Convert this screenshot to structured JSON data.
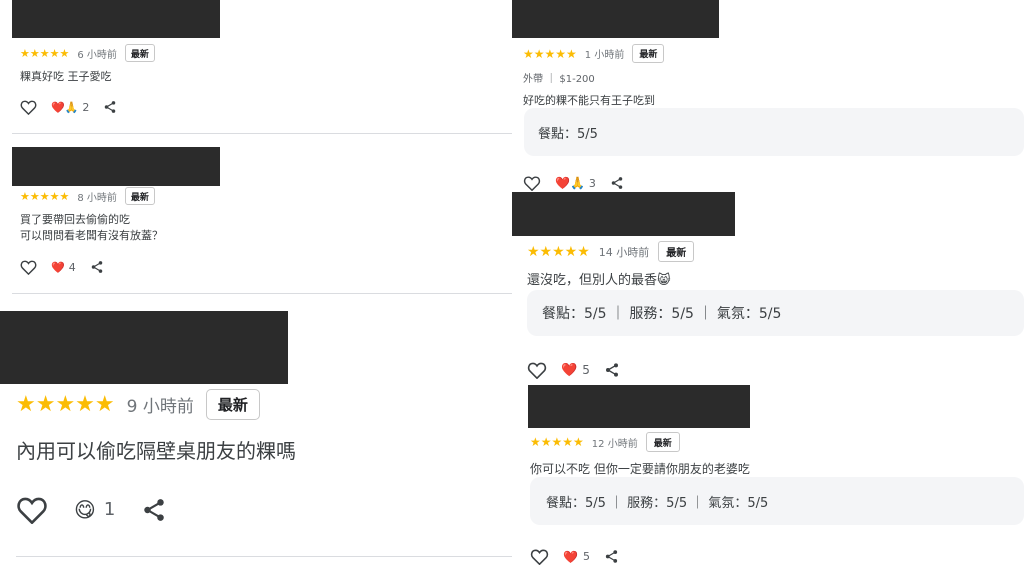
{
  "reviews": [
    {
      "stars": "★★★★★",
      "time": "6 小時前",
      "badge": "最新",
      "text": "粿真好吃 王子愛吃",
      "reaction_count": "2",
      "reaction_emoji": "❤️🙏"
    },
    {
      "stars": "★★★★★",
      "time": "8 小時前",
      "badge": "最新",
      "text_line1": "買了要帶回去偷偷的吃",
      "text_line2": "可以問問看老闆有沒有放蓋？",
      "reaction_count": "4",
      "reaction_emoji": "❤️"
    },
    {
      "stars": "★★★★★",
      "time": "9 小時前",
      "badge": "最新",
      "text": "內用可以偷吃隔壁桌朋友的粿嗎",
      "reaction_count": "1",
      "reaction_emoji": "😋"
    },
    {
      "stars": "★★★★★",
      "time": "1 小時前",
      "badge": "最新",
      "meta": "外帶 ｜ $1-200",
      "text": "好吃的粿不能只有王子吃到",
      "rating": "餐點：5/5",
      "reaction_count": "3",
      "reaction_emoji": "❤️🙏"
    },
    {
      "stars": "★★★★★",
      "time": "14 小時前",
      "badge": "最新",
      "text": "還沒吃，但別人的最香😸",
      "rating": "餐點：5/5 ｜ 服務：5/5 ｜ 氣氛：5/5",
      "reaction_count": "5",
      "reaction_emoji": "❤️"
    },
    {
      "stars": "★★★★★",
      "time": "12 小時前",
      "badge": "最新",
      "text": "你可以不吃 但你一定要請你朋友的老婆吃",
      "rating": "餐點：5/5 ｜ 服務：5/5 ｜ 氣氛：5/5",
      "reaction_count": "5",
      "reaction_emoji": "❤️"
    }
  ],
  "icons": {
    "like": "heart-outline-icon",
    "share": "share-icon"
  },
  "colors": {
    "star": "#fbbc04",
    "heart": "#e53935",
    "redaction": "#2b2b2b"
  }
}
